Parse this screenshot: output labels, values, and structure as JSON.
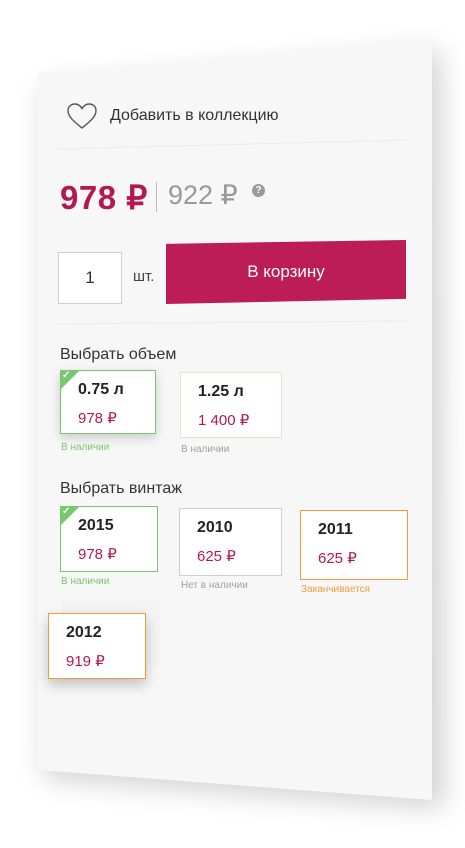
{
  "collection": {
    "add_label": "Добавить в коллекцию"
  },
  "price": {
    "current": "978 ₽",
    "old": "922 ₽",
    "help_icon": "?"
  },
  "quantity": {
    "value": "1",
    "unit": "шт."
  },
  "cart": {
    "button_label": "В корзину"
  },
  "volume": {
    "title": "Выбрать объем",
    "options": [
      {
        "name": "0.75 л",
        "price": "978 ₽",
        "status": "В наличии",
        "selected": true
      },
      {
        "name": "1.25 л",
        "price": "1 400 ₽",
        "status": "В наличии",
        "selected": false
      }
    ]
  },
  "vintage": {
    "title": "Выбрать винтаж",
    "options": [
      {
        "name": "2015",
        "price": "978 ₽",
        "status": "В наличии",
        "selected": true
      },
      {
        "name": "2010",
        "price": "625 ₽",
        "status": "Нет в наличии",
        "selected": false
      },
      {
        "name": "2011",
        "price": "625 ₽",
        "status": "Заканчивается",
        "selected": false
      },
      {
        "name": "2012",
        "price": "919 ₽",
        "status": "",
        "selected": false
      }
    ]
  },
  "colors": {
    "accent": "#bd1d55",
    "price": "#b3194f",
    "available": "#7bc56f",
    "ending": "#f39a3e",
    "unavailable": "#a0a0a0"
  }
}
